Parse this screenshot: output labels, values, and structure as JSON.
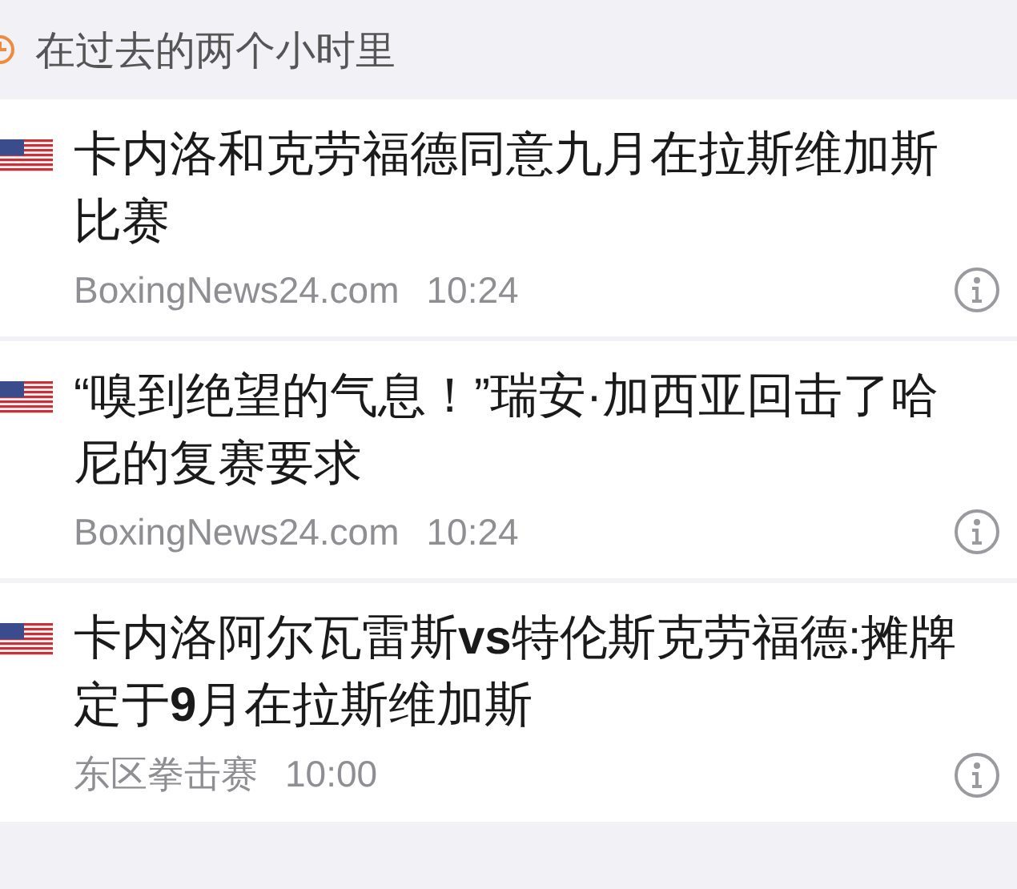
{
  "header": {
    "label": "在过去的两个小时里"
  },
  "articles": [
    {
      "title": "卡内洛和克劳福德同意九月在拉斯维加斯比赛",
      "source": "BoxingNews24.com",
      "time": "10:24"
    },
    {
      "title": "“嗅到绝望的气息！”瑞安·加西亚回击了哈尼的复赛要求",
      "source": "BoxingNews24.com",
      "time": "10:24"
    },
    {
      "title": "卡内洛阿尔瓦雷斯**vs**特伦斯克劳福德:摊牌定于**9**月在拉斯维加斯",
      "source": "东区拳击赛",
      "time": "10:00"
    }
  ]
}
